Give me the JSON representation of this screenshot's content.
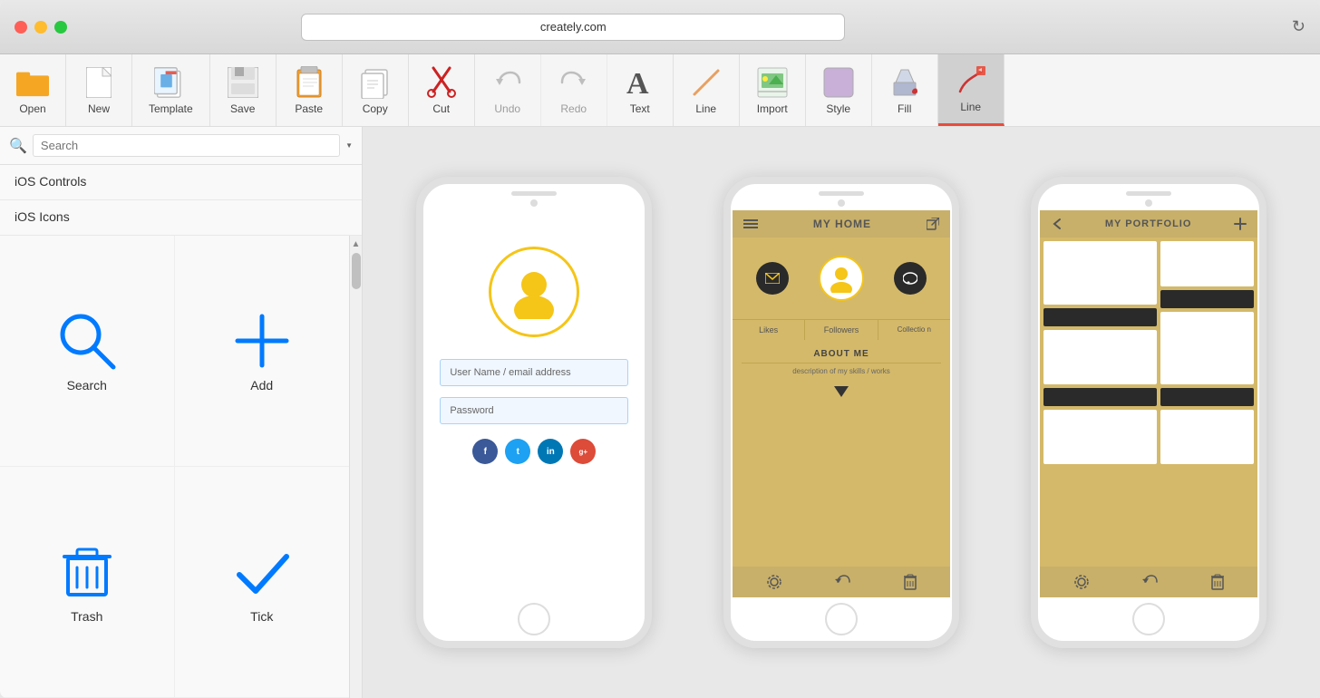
{
  "window": {
    "url": "creately.com"
  },
  "toolbar": {
    "items": [
      {
        "id": "open",
        "label": "Open",
        "icon": "folder-icon"
      },
      {
        "id": "new",
        "label": "New",
        "icon": "new-icon"
      },
      {
        "id": "template",
        "label": "Template",
        "icon": "template-icon"
      },
      {
        "id": "save",
        "label": "Save",
        "icon": "save-icon"
      },
      {
        "id": "paste",
        "label": "Paste",
        "icon": "paste-icon"
      },
      {
        "id": "copy",
        "label": "Copy",
        "icon": "copy-icon"
      },
      {
        "id": "cut",
        "label": "Cut",
        "icon": "cut-icon"
      },
      {
        "id": "undo",
        "label": "Undo",
        "icon": "undo-icon"
      },
      {
        "id": "redo",
        "label": "Redo",
        "icon": "redo-icon"
      },
      {
        "id": "text",
        "label": "Text",
        "icon": "text-icon"
      },
      {
        "id": "line",
        "label": "Line",
        "icon": "line-icon"
      },
      {
        "id": "import",
        "label": "Import",
        "icon": "import-icon"
      },
      {
        "id": "style",
        "label": "Style",
        "icon": "style-icon"
      },
      {
        "id": "fill",
        "label": "Fill",
        "icon": "fill-icon"
      },
      {
        "id": "line2",
        "label": "Line",
        "icon": "line2-icon"
      }
    ]
  },
  "sidebar": {
    "search_placeholder": "Search",
    "sections": [
      {
        "label": "iOS Controls"
      },
      {
        "label": "iOS Icons"
      }
    ],
    "icons": [
      {
        "id": "search",
        "label": "Search"
      },
      {
        "id": "add",
        "label": "Add"
      },
      {
        "id": "trash",
        "label": "Trash"
      },
      {
        "id": "tick",
        "label": "Tick"
      }
    ]
  },
  "phones": [
    {
      "id": "phone1",
      "type": "login",
      "fields": [
        "User Name / email address",
        "Password"
      ],
      "social": [
        "f",
        "t",
        "in",
        "g+"
      ]
    },
    {
      "id": "phone2",
      "type": "home",
      "title": "MY HOME",
      "tabs": [
        "Likes",
        "Followers",
        "Collection"
      ],
      "about_title": "ABOUT ME",
      "about_desc": "description of my skills / works"
    },
    {
      "id": "phone3",
      "type": "portfolio",
      "title": "MY PORTFOLIO"
    }
  ],
  "colors": {
    "accent_blue": "#007aff",
    "golden": "#d4b96a",
    "golden_dark": "#c8b06a",
    "dark": "#2a2a2a",
    "toolbar_active": "#cc3333"
  }
}
